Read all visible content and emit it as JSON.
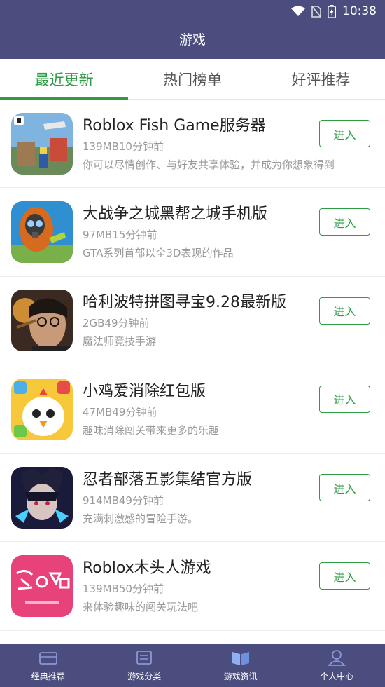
{
  "status_bar": {
    "time": "10:38"
  },
  "header": {
    "title": "游戏"
  },
  "tabs": [
    {
      "label": "最近更新",
      "active": true
    },
    {
      "label": "热门榜单",
      "active": false
    },
    {
      "label": "好评推荐",
      "active": false
    }
  ],
  "games": [
    {
      "name": "Roblox Fish Game服务器",
      "meta": "139MB10分钟前",
      "desc": "你可以尽情创作、与好友共享体验，并成为你想象得到",
      "button": "进入",
      "icon": "roblox-fish-icon"
    },
    {
      "name": "大战争之城黑帮之城手机版",
      "meta": "97MB15分钟前",
      "desc": "GTA系列首部以全3D表现的作品",
      "button": "进入",
      "icon": "gang-city-icon"
    },
    {
      "name": "哈利波特拼图寻宝9.28最新版",
      "meta": "2GB49分钟前",
      "desc": "魔法师竞技手游",
      "button": "进入",
      "icon": "harry-potter-icon"
    },
    {
      "name": "小鸡爱消除红包版",
      "meta": "47MB49分钟前",
      "desc": "趣味消除闯关带来更多的乐趣",
      "button": "进入",
      "icon": "chick-icon"
    },
    {
      "name": "忍者部落五影集结官方版",
      "meta": "914MB49分钟前",
      "desc": "充满刺激感的冒险手游。",
      "button": "进入",
      "icon": "ninja-icon"
    },
    {
      "name": "Roblox木头人游戏",
      "meta": "139MB50分钟前",
      "desc": "来体验趣味的闯关玩法吧",
      "button": "进入",
      "icon": "squid-game-icon"
    }
  ],
  "bottom_nav": [
    {
      "label": "经典推荐",
      "icon": "classic-icon"
    },
    {
      "label": "游戏分类",
      "icon": "category-icon"
    },
    {
      "label": "游戏资讯",
      "icon": "news-icon"
    },
    {
      "label": "个人中心",
      "icon": "user-icon"
    }
  ],
  "colors": {
    "header": "#4a4d7d",
    "accent": "#2e9b45"
  }
}
